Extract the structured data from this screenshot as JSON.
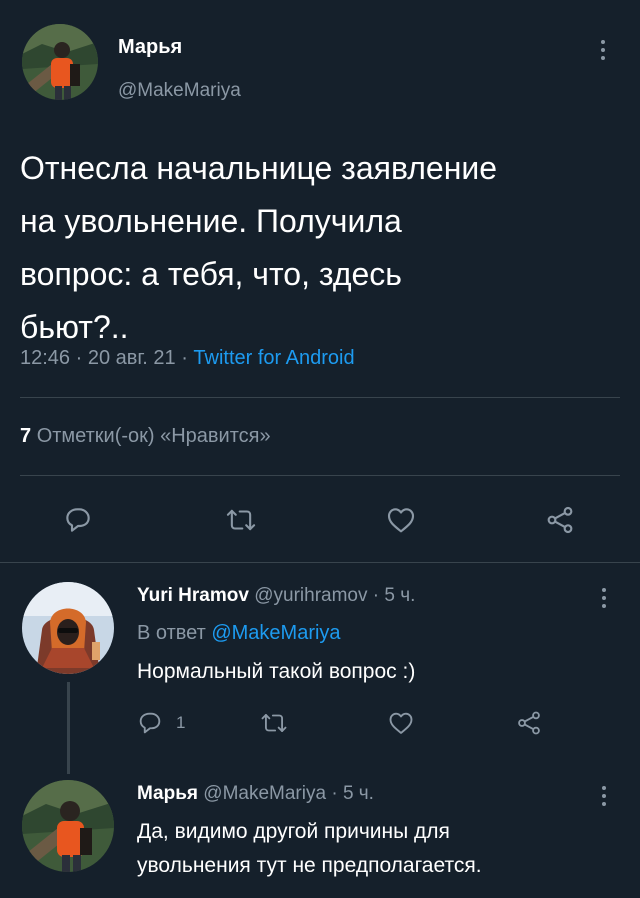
{
  "main_tweet": {
    "author_name": "Марья",
    "author_handle": "@MakeMariya",
    "text_lines": [
      "Отнесла начальнице заявление",
      "на увольнение. Получила",
      "вопрос: а тебя, что, здесь",
      "бьют?.."
    ],
    "time": "12:46",
    "date": "20 авг. 21",
    "separator": "·",
    "source": "Twitter for Android",
    "likes_count": "7",
    "likes_label": "Отметки(-ок) «Нравится»"
  },
  "reply_1": {
    "author_name": "Yuri Hramov",
    "author_handle": "@yurihramov",
    "time": "5 ч.",
    "separator": "·",
    "reply_to_label": "В ответ",
    "reply_to_handle": "@MakeMariya",
    "text": "Нормальный такой вопрос :)",
    "reply_count": "1"
  },
  "reply_2": {
    "author_name": "Марья",
    "author_handle": "@MakeMariya",
    "time": "5 ч.",
    "separator": "·",
    "text_lines": [
      "Да, видимо другой причины для",
      "увольнения тут не предполагается."
    ]
  },
  "icons": {
    "reply": "reply-icon",
    "retweet": "retweet-icon",
    "like": "like-icon",
    "share": "share-icon",
    "more": "more-icon"
  },
  "colors": {
    "background": "#15202b",
    "text": "#ffffff",
    "muted": "#8b98a5",
    "link": "#1d9bf0",
    "divider": "#38444d",
    "avatar_jacket": "#e8561f"
  }
}
